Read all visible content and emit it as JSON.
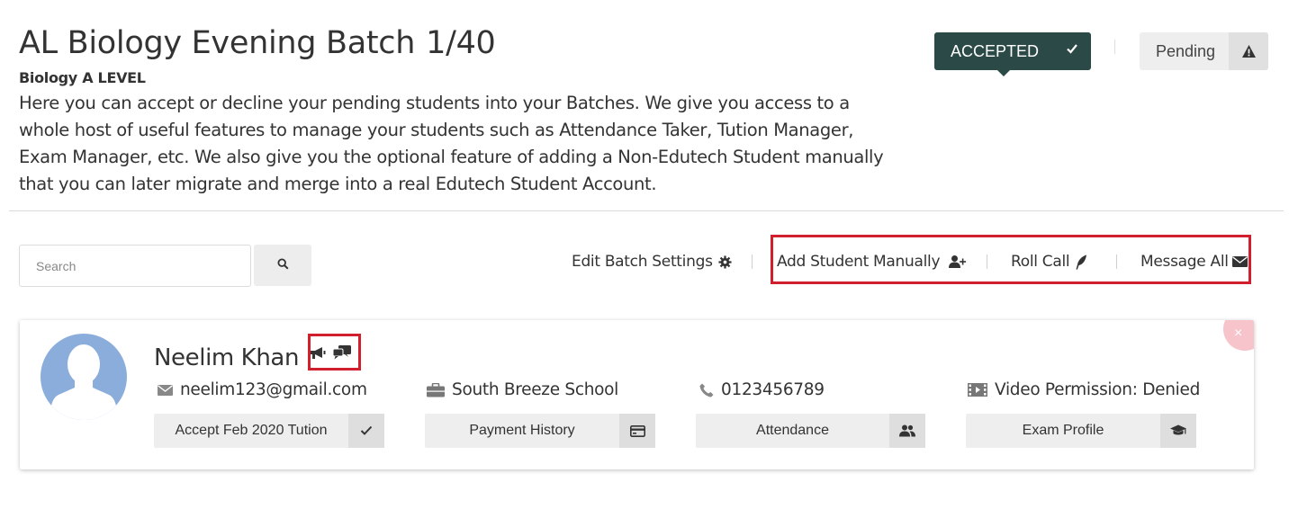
{
  "header": {
    "title": "AL Biology Evening Batch",
    "count": "1/40",
    "subtitle": "Biology A LEVEL",
    "description": "Here you can accept or decline your pending students into your Batches. We give you access to a whole host of useful features to manage your students such as Attendance Taker, Tution Manager, Exam Manager, etc. We also give you the optional feature of adding a Non-Edutech Student manually that you can later migrate and merge into a real Edutech Student Account."
  },
  "tabs": {
    "accepted_label": "ACCEPTED",
    "pending_label": "Pending"
  },
  "toolbar": {
    "search_placeholder": "Search",
    "edit_batch_settings": "Edit Batch Settings",
    "add_student_manually": "Add Student Manually",
    "roll_call": "Roll Call",
    "message_all": "Message All"
  },
  "student": {
    "name": "Neelim Khan",
    "email": "neelim123@gmail.com",
    "school": "South Breeze School",
    "phone": "0123456789",
    "video_permission": "Video Permission: Denied",
    "accept_tuition": "Accept Feb 2020 Tution",
    "payment_history": "Payment History",
    "attendance": "Attendance",
    "exam_profile": "Exam Profile"
  },
  "colors": {
    "accent_dark_green": "#2b4a47",
    "highlight_red": "#d11f2e",
    "avatar_blue": "#8aaddb",
    "close_pink": "#f7c4cb"
  },
  "icons": [
    "check-icon",
    "warning-icon",
    "search-icon",
    "gear-icon",
    "user-plus-icon",
    "quill-icon",
    "envelope-icon",
    "megaphone-icon",
    "chat-icon",
    "briefcase-icon",
    "phone-icon",
    "video-icon",
    "credit-card-icon",
    "users-icon",
    "graduation-cap-icon",
    "close-icon"
  ]
}
